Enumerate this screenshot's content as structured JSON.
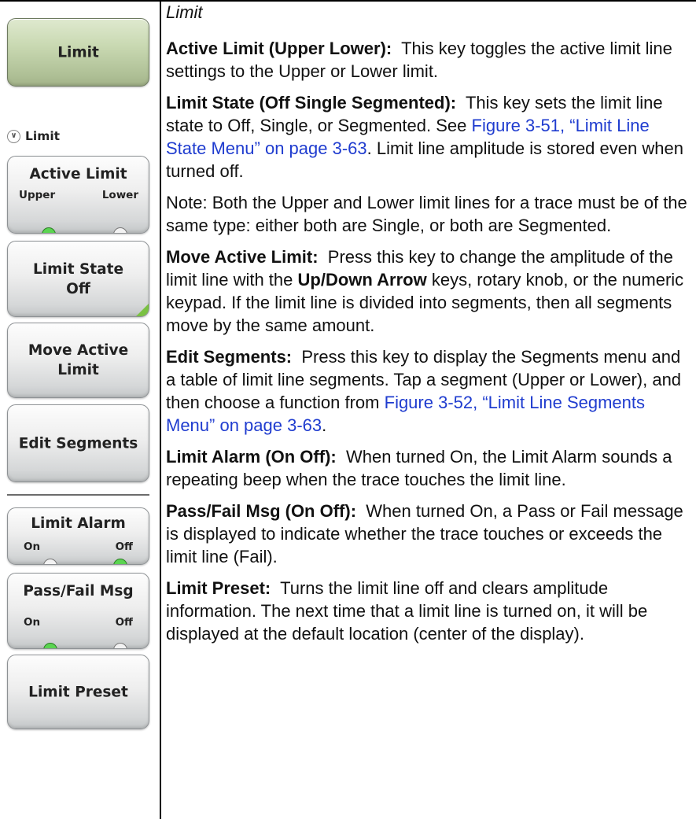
{
  "menu": {
    "top_button": "Limit",
    "submenu_heading": "Limit",
    "active_limit": {
      "label": "Active Limit",
      "option_a": "Upper",
      "option_b": "Lower",
      "selected": "Upper"
    },
    "limit_state": {
      "line1": "Limit State",
      "line2": "Off"
    },
    "move_active_limit": {
      "line1": "Move Active",
      "line2": "Limit"
    },
    "edit_segments": "Edit Segments",
    "limit_alarm": {
      "label": "Limit Alarm",
      "option_a": "On",
      "option_b": "Off",
      "selected": "Off"
    },
    "pass_fail": {
      "label": "Pass/Fail Msg",
      "option_a": "On",
      "option_b": "Off",
      "selected": "On"
    },
    "limit_preset": "Limit Preset"
  },
  "description": {
    "header": "Limit",
    "active_limit": {
      "term": "Active Limit (Upper  Lower):",
      "text": "This key toggles the active limit line settings to the Upper or Lower limit."
    },
    "limit_state": {
      "term": "Limit State (Off  Single  Segmented):",
      "text_a": "This key sets the limit line state to Off, Single, or Segmented. See",
      "link": "Figure 3-51, “Limit Line State Menu” on page 3-63",
      "text_b": ". Limit line amplitude is stored even when turned off."
    },
    "note": "Note: Both the Upper and Lower limit lines for a trace must be of the same type: either both are Single, or both are Segmented.",
    "move_active_limit": {
      "term": "Move Active Limit:",
      "text_a": "Press this key to change the amplitude of the limit line with the",
      "key": "Up/Down Arrow",
      "text_b": "keys, rotary knob, or the numeric keypad. If the limit line is divided into segments, then all segments move by the same amount."
    },
    "edit_segments": {
      "term": "Edit Segments:",
      "text_a": "Press this key to display the Segments menu and a table of limit line segments. Tap a segment (Upper or Lower), and then choose a function from",
      "link": "Figure 3-52, “Limit Line Segments Menu” on page 3-63",
      "text_b": "."
    },
    "limit_alarm": {
      "term": "Limit Alarm (On  Off):",
      "text": "When turned On, the Limit Alarm sounds a repeating beep when the trace touches the limit line."
    },
    "pass_fail": {
      "term": "Pass/Fail Msg (On  Off):",
      "text": "When turned On, a Pass or Fail message is displayed to indicate whether the trace touches or exceeds the limit line (Fail)."
    },
    "limit_preset": {
      "term": "Limit Preset:",
      "text": "Turns the limit line off and clears amplitude information. The next time that a limit line is turned on, it will be displayed at the default location (center of the display)."
    }
  }
}
